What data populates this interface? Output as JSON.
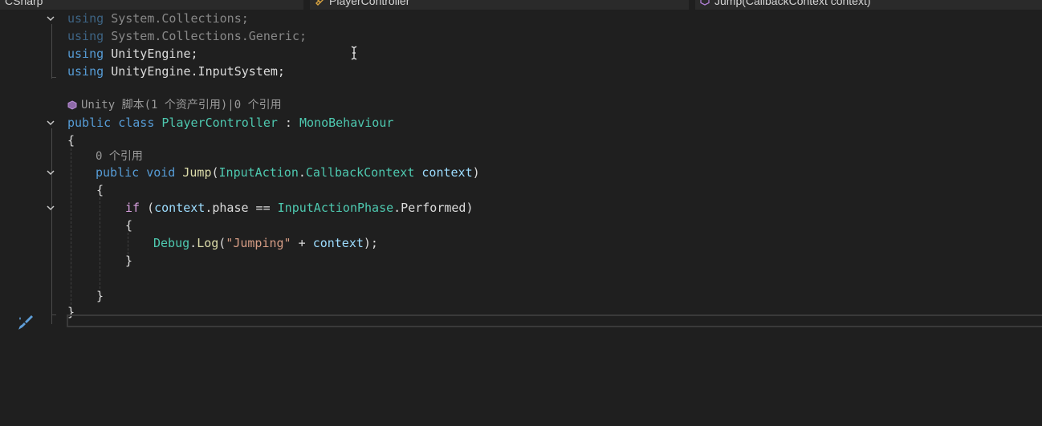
{
  "navbar": {
    "project": "CSharp",
    "type": "PlayerController",
    "member": "Jump(CallbackContext context)"
  },
  "code": {
    "line1": {
      "kw": "using",
      "ns": "System.Collections;"
    },
    "line2": {
      "kw": "using",
      "ns": "System.Collections.Generic;"
    },
    "line3": {
      "kw": "using",
      "ns": "UnityEngine;"
    },
    "line4": {
      "kw": "using",
      "ns": "UnityEngine.InputSystem;"
    },
    "lens_class": "Unity 脚本(1 个资产引用)|0 个引用",
    "class_decl": {
      "kw1": "public",
      "kw2": "class",
      "name": "PlayerController",
      "sep": " : ",
      "base": "MonoBehaviour"
    },
    "open_brace": "{",
    "lens_method": "0 个引用",
    "method_decl": {
      "kw1": "public",
      "kw2": "void",
      "name": "Jump",
      "open": "(",
      "ptype_a": "InputAction",
      "dot": ".",
      "ptype_b": "CallbackContext",
      "pname": "context",
      "close": ")"
    },
    "method_open": "{",
    "if_stmt": {
      "kw": "if",
      "open": " (",
      "var": "context",
      "member": ".phase == ",
      "enum_type": "InputActionPhase",
      "enum_val": ".Performed)"
    },
    "if_open": "{",
    "debug_stmt": {
      "type": "Debug",
      "dot": ".",
      "method": "Log",
      "open": "(",
      "str": "\"Jumping\"",
      "plus": " + ",
      "var": "context",
      "close": ");"
    },
    "if_close": "}",
    "method_close": "}",
    "class_close": "}"
  },
  "icons": {
    "fold": "chevron-down-icon",
    "unity": "unity-cube-icon",
    "brush": "paintbrush-icon",
    "cursor": "text-cursor-icon"
  },
  "colors": {
    "background": "#1f1f1f",
    "keyword": "#569cd6",
    "type": "#4ec9b0",
    "parameter": "#9cdcfe",
    "method": "#dcdcaa",
    "string": "#d69d85",
    "control": "#d8a0df",
    "text": "#dcdcdc"
  }
}
